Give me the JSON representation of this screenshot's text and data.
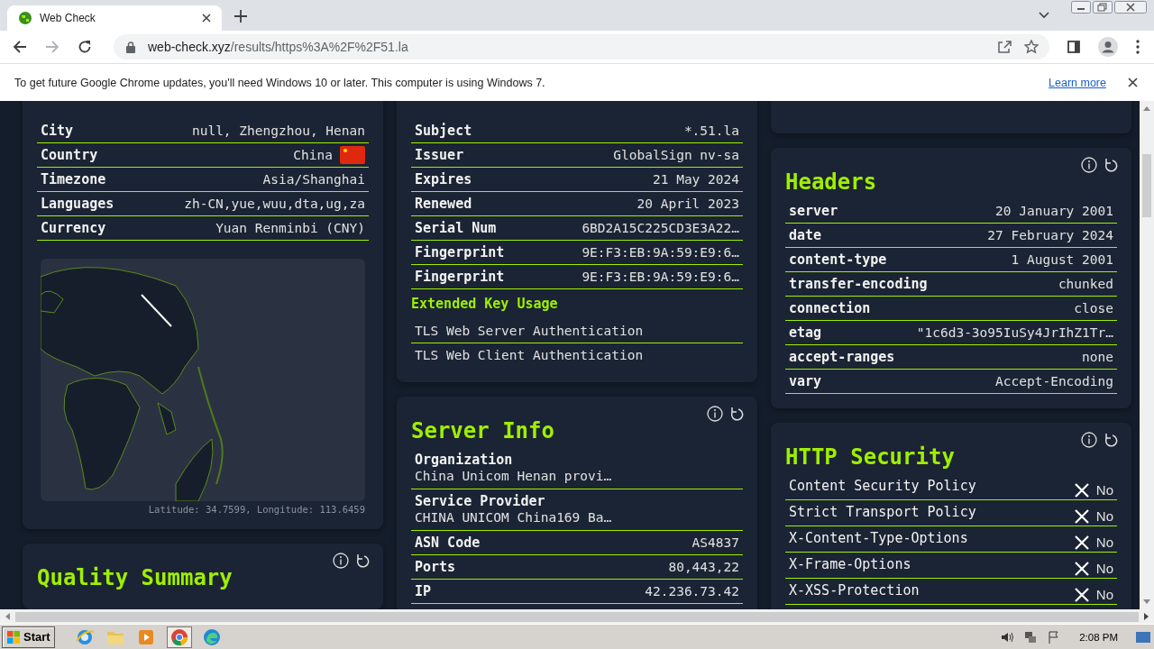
{
  "browser": {
    "tab_title": "Web Check",
    "url_host": "web-check.xyz",
    "url_path": "/results/https%3A%2F%2F51.la"
  },
  "infobar": {
    "message": "To get future Google Chrome updates, you'll need Windows 10 or later. This computer is using Windows 7.",
    "link": "Learn more"
  },
  "columns": [
    [
      {
        "kind": "card",
        "items": [
          {
            "kind": "row",
            "label": "City",
            "value": "null, Zhengzhou, Henan"
          },
          {
            "kind": "row_flag",
            "label": "Country",
            "value": "China"
          },
          {
            "kind": "row",
            "label": "Timezone",
            "value": "Asia/Shanghai"
          },
          {
            "kind": "row",
            "label": "Languages",
            "value": "zh-CN,yue,wuu,dta,ug,za"
          },
          {
            "kind": "row",
            "label": "Currency",
            "value": "Yuan Renminbi (CNY)"
          },
          {
            "kind": "map",
            "caption": "Latitude: 34.7599, Longitude: 113.6459"
          }
        ]
      },
      {
        "kind": "card",
        "title": "Quality Summary",
        "actions": true
      }
    ],
    [
      {
        "kind": "card",
        "items": [
          {
            "kind": "row",
            "label": "Subject",
            "value": "*.51.la"
          },
          {
            "kind": "row",
            "label": "Issuer",
            "value": "GlobalSign nv-sa"
          },
          {
            "kind": "row",
            "label": "Expires",
            "value": "21 May 2024"
          },
          {
            "kind": "row",
            "label": "Renewed",
            "value": "20 April 2023"
          },
          {
            "kind": "row",
            "label": "Serial Num",
            "value": "6BD2A15C225CD3E3A22…"
          },
          {
            "kind": "row",
            "label": "Fingerprint",
            "value": "9E:F3:EB:9A:59:E9:6…"
          },
          {
            "kind": "row",
            "label": "Fingerprint",
            "value": "9E:F3:EB:9A:59:E9:6…"
          },
          {
            "kind": "subheading",
            "text": "Extended Key Usage"
          },
          {
            "kind": "plain",
            "text": "TLS Web Server Authentication",
            "ruled": true
          },
          {
            "kind": "plain",
            "text": "TLS Web Client Authentication",
            "ruled": false
          }
        ]
      },
      {
        "kind": "card",
        "title": "Server Info",
        "actions": true,
        "items": [
          {
            "kind": "stacked",
            "label": "Organization",
            "value": "China Unicom Henan provi…"
          },
          {
            "kind": "stacked",
            "label": "Service Provider",
            "value": "CHINA UNICOM China169 Ba…"
          },
          {
            "kind": "row",
            "label": "ASN Code",
            "value": "AS4837"
          },
          {
            "kind": "row",
            "label": "Ports",
            "value": "80,443,22"
          },
          {
            "kind": "row",
            "label": "IP",
            "value": "42.236.73.42"
          }
        ]
      }
    ],
    [
      {
        "kind": "card"
      },
      {
        "kind": "card",
        "title": "Headers",
        "actions": true,
        "items": [
          {
            "kind": "row",
            "label": "server",
            "value": "20 January 2001"
          },
          {
            "kind": "row",
            "label": "date",
            "value": "27 February 2024"
          },
          {
            "kind": "row",
            "label": "content-type",
            "value": "1 August 2001"
          },
          {
            "kind": "row",
            "label": "transfer-encoding",
            "value": "chunked"
          },
          {
            "kind": "row",
            "label": "connection",
            "value": "close"
          },
          {
            "kind": "row",
            "label": "etag",
            "value": "\"1c6d3-3o95IuSy4JrIhZ1Tr…"
          },
          {
            "kind": "row",
            "label": "accept-ranges",
            "value": "none"
          },
          {
            "kind": "row",
            "label": "vary",
            "value": "Accept-Encoding"
          }
        ]
      },
      {
        "kind": "card",
        "title": "HTTP Security",
        "actions": true,
        "items": [
          {
            "kind": "check",
            "label": "Content Security Policy",
            "passed": false,
            "value": "No"
          },
          {
            "kind": "check",
            "label": "Strict Transport Policy",
            "passed": false,
            "value": "No"
          },
          {
            "kind": "check",
            "label": "X-Content-Type-Options",
            "passed": false,
            "value": "No"
          },
          {
            "kind": "check",
            "label": "X-Frame-Options",
            "passed": false,
            "value": "No"
          },
          {
            "kind": "check",
            "label": "X-XSS-Protection",
            "passed": false,
            "value": "No"
          }
        ]
      }
    ]
  ],
  "taskbar": {
    "start": "Start",
    "clock": "2:08 PM"
  }
}
